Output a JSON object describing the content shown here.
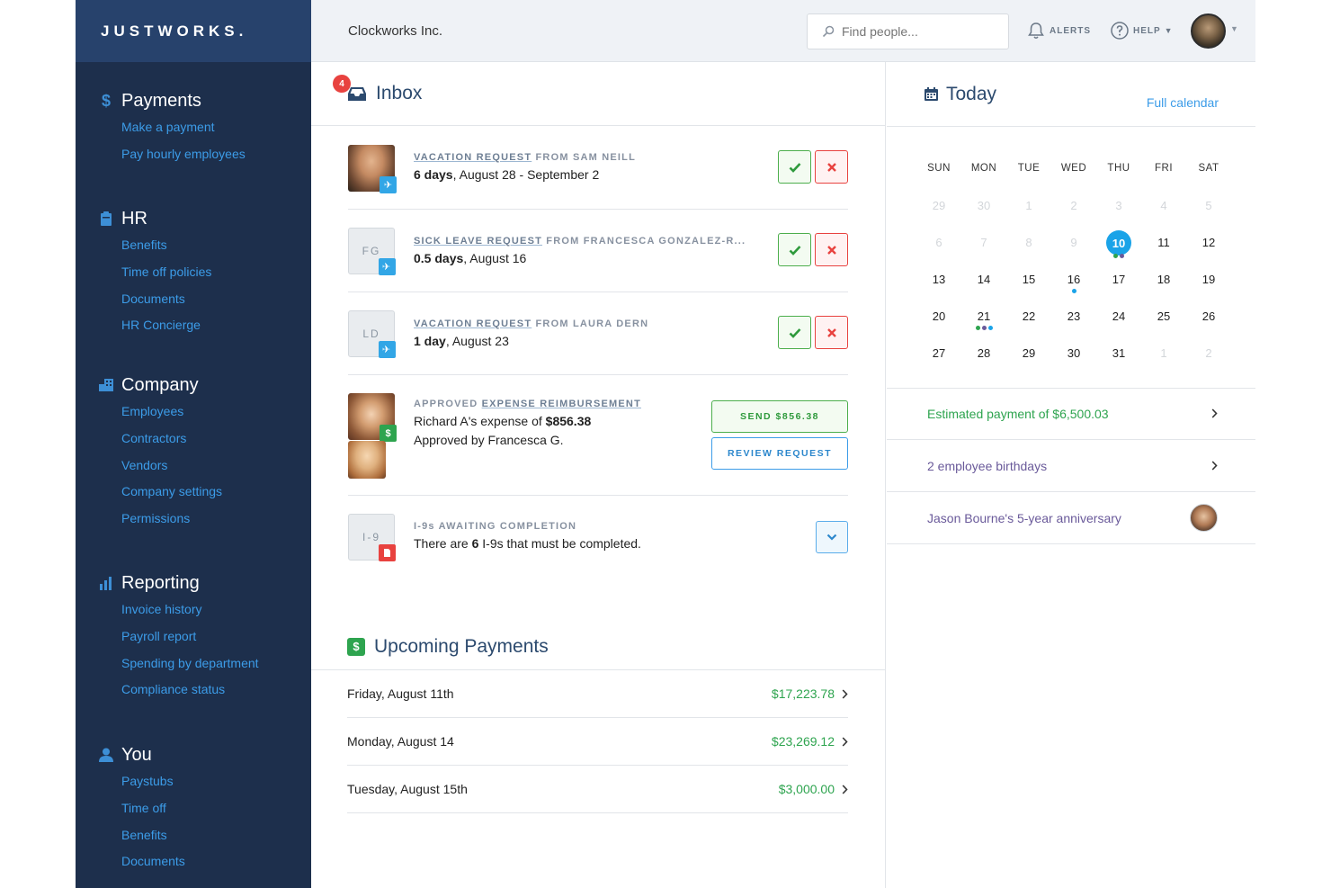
{
  "brand": {
    "logo": "JUSTWORKS."
  },
  "topbar": {
    "company": "Clockworks Inc.",
    "search_placeholder": "Find people...",
    "alerts_label": "ALERTS",
    "help_label": "HELP"
  },
  "sidebar": {
    "sections": [
      {
        "title": "Payments",
        "icon": "dollar-icon",
        "links": [
          "Make a payment",
          "Pay hourly employees"
        ]
      },
      {
        "title": "HR",
        "icon": "clipboard-icon",
        "links": [
          "Benefits",
          "Time off policies",
          "Documents",
          "HR Concierge"
        ]
      },
      {
        "title": "Company",
        "icon": "building-icon",
        "links": [
          "Employees",
          "Contractors",
          "Vendors",
          "Company settings",
          "Permissions"
        ]
      },
      {
        "title": "Reporting",
        "icon": "bar-chart-icon",
        "links": [
          "Invoice history",
          "Payroll report",
          "Spending by department",
          "Compliance status"
        ]
      },
      {
        "title": "You",
        "icon": "person-icon",
        "links": [
          "Paystubs",
          "Time off",
          "Benefits",
          "Documents"
        ]
      }
    ]
  },
  "inbox": {
    "title": "Inbox",
    "badge_count": "4",
    "items": [
      {
        "type_link": "VACATION REQUEST",
        "type_rest": " FROM SAM NEILL",
        "bold": "6 days",
        "rest": ", August 28 - September 2",
        "thumb": "photo"
      },
      {
        "type_link": "SICK LEAVE REQUEST",
        "type_rest": " FROM FRANCESCA GONZALEZ-R...",
        "bold": "0.5 days",
        "rest": ", August 16",
        "initials": "FG"
      },
      {
        "type_link": "VACATION REQUEST",
        "type_rest": " FROM LAURA DERN",
        "bold": "1 day",
        "rest": ", August 23",
        "initials": "LD"
      },
      {
        "type_pre": "APPROVED ",
        "type_link": "EXPENSE REIMBURSEMENT",
        "line1_pre": "Richard A's expense of ",
        "line1_bold": "$856.38",
        "line2": "Approved by Francesca G.",
        "send_label": "SEND $856.38",
        "review_label": "REVIEW REQUEST"
      },
      {
        "type_rest": "I-9s AWAITING COMPLETION",
        "text_pre": "There are ",
        "text_bold": "6",
        "text_post": " I-9s that must be completed.",
        "initials": "I-9"
      }
    ]
  },
  "upcoming": {
    "title": "Upcoming Payments",
    "rows": [
      {
        "date": "Friday, August 11th",
        "amount": "$17,223.78"
      },
      {
        "date": "Monday, August 14",
        "amount": "$23,269.12"
      },
      {
        "date": "Tuesday, August 15th",
        "amount": "$3,000.00"
      }
    ]
  },
  "today": {
    "title": "Today",
    "full_calendar": "Full calendar",
    "weekdays": [
      "SUN",
      "MON",
      "TUE",
      "WED",
      "THU",
      "FRI",
      "SAT"
    ],
    "weeks": [
      [
        {
          "d": "29",
          "m": true
        },
        {
          "d": "30",
          "m": true
        },
        {
          "d": "1",
          "m": true
        },
        {
          "d": "2",
          "m": true
        },
        {
          "d": "3",
          "m": true
        },
        {
          "d": "4",
          "m": true
        },
        {
          "d": "5",
          "m": true
        }
      ],
      [
        {
          "d": "6",
          "m": true
        },
        {
          "d": "7",
          "m": true
        },
        {
          "d": "8",
          "m": true
        },
        {
          "d": "9",
          "m": true
        },
        {
          "d": "10",
          "today": true,
          "dots": [
            "#2ea44f",
            "#6a5a9a"
          ]
        },
        {
          "d": "11"
        },
        {
          "d": "12"
        }
      ],
      [
        {
          "d": "13"
        },
        {
          "d": "14"
        },
        {
          "d": "15"
        },
        {
          "d": "16",
          "dots": [
            "#1aa3e8"
          ]
        },
        {
          "d": "17"
        },
        {
          "d": "18"
        },
        {
          "d": "19"
        }
      ],
      [
        {
          "d": "20"
        },
        {
          "d": "21",
          "dots": [
            "#2ea44f",
            "#6a5a9a",
            "#1aa3e8"
          ]
        },
        {
          "d": "22"
        },
        {
          "d": "23"
        },
        {
          "d": "24"
        },
        {
          "d": "25"
        },
        {
          "d": "26"
        }
      ],
      [
        {
          "d": "27"
        },
        {
          "d": "28"
        },
        {
          "d": "29"
        },
        {
          "d": "30"
        },
        {
          "d": "31"
        },
        {
          "d": "1",
          "m": true
        },
        {
          "d": "2",
          "m": true
        }
      ]
    ],
    "events": [
      {
        "text": "Estimated payment of $6,500.03",
        "color": "green",
        "action": "chevron"
      },
      {
        "text": "2 employee birthdays",
        "color": "purple",
        "action": "chevron"
      },
      {
        "text": "Jason Bourne's 5-year anniversary",
        "color": "purple",
        "action": "avatar"
      }
    ]
  }
}
